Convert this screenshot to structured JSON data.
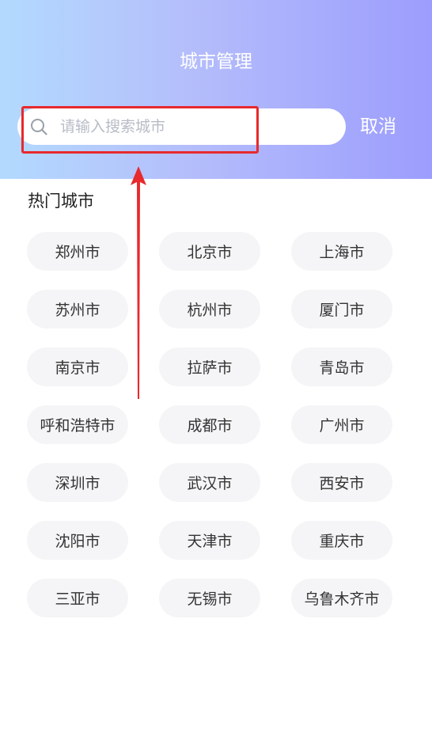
{
  "header": {
    "title": "城市管理",
    "cancel_label": "取消"
  },
  "search": {
    "placeholder": "请输入搜索城市",
    "value": ""
  },
  "hot_cities": {
    "title": "热门城市",
    "items": [
      "郑州市",
      "北京市",
      "上海市",
      "苏州市",
      "杭州市",
      "厦门市",
      "南京市",
      "拉萨市",
      "青岛市",
      "呼和浩特市",
      "成都市",
      "广州市",
      "深圳市",
      "武汉市",
      "西安市",
      "沈阳市",
      "天津市",
      "重庆市",
      "三亚市",
      "无锡市",
      "乌鲁木齐市"
    ]
  },
  "colors": {
    "header_gradient_start": "#b3dafe",
    "header_gradient_end": "#9c9dfd",
    "highlight": "#e8292d",
    "chip_background": "#f5f5f7"
  }
}
